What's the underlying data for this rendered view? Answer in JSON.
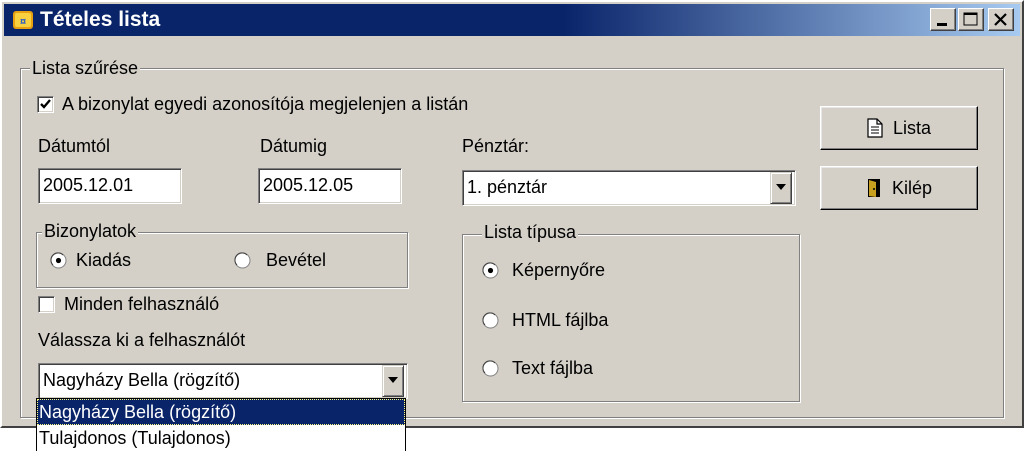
{
  "window": {
    "title": "Tételes lista"
  },
  "filter": {
    "group_label": "Lista szűrése",
    "show_id_label": "A bizonylat egyedi azonosítója megjelenjen a listán",
    "show_id_checked": true,
    "date_from_label": "Dátumtól",
    "date_to_label": "Dátumig",
    "date_from_value": "2005.12.01",
    "date_to_value": "2005.12.05",
    "cashdesk_label": "Pénztár:",
    "cashdesk_value": "1. pénztár",
    "documents": {
      "label": "Bizonylatok",
      "options": [
        "Kiadás",
        "Bevétel"
      ],
      "selected": "Kiadás"
    },
    "all_users_label": "Minden felhasználó",
    "all_users_checked": false,
    "choose_user_label": "Válassza ki a felhasználót",
    "user_value": "Nagyházy Bella (rögzítő)",
    "user_options": [
      "Nagyházy Bella (rögzítő)",
      "Tulajdonos (Tulajdonos)"
    ],
    "list_type": {
      "label": "Lista típusa",
      "options": [
        "Képernyőre",
        "HTML fájlba",
        "Text fájlba"
      ],
      "selected": "Képernyőre"
    }
  },
  "buttons": {
    "list_label": "Lista",
    "exit_label": "Kilép"
  },
  "icons": [
    "app-icon",
    "minimize-icon",
    "maximize-icon",
    "close-icon",
    "document-icon",
    "door-exit-icon",
    "chevron-down-icon",
    "checkmark-icon"
  ]
}
